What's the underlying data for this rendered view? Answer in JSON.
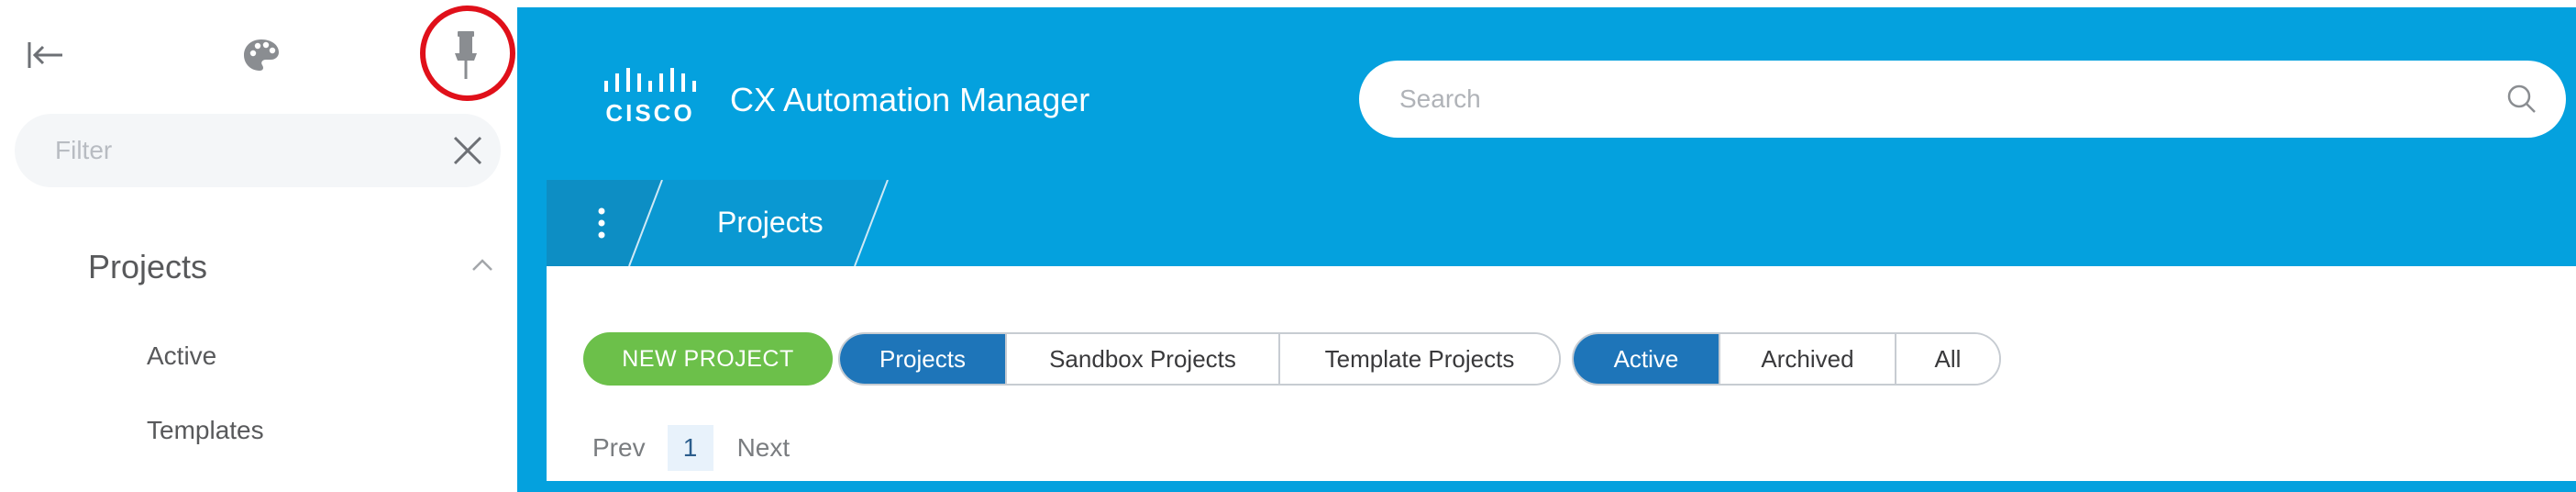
{
  "sidebar": {
    "filter_placeholder": "Filter",
    "section_title": "Projects",
    "items": [
      {
        "label": "Active"
      },
      {
        "label": "Templates"
      }
    ],
    "icons": {
      "collapse": "collapse-sidebar-icon",
      "theme": "palette-icon",
      "pin": "pin-icon",
      "clear": "close-icon",
      "section": "chevron-up-icon"
    },
    "highlight_color": "#e0101a"
  },
  "header": {
    "logo_text": "CISCO",
    "app_title": "CX Automation Manager",
    "search_placeholder": "Search",
    "accent_color": "#04a1de"
  },
  "breadcrumb": {
    "current": "Projects"
  },
  "toolbar": {
    "new_project_label": "NEW PROJECT",
    "new_project_color": "#6cc04a",
    "project_types": [
      "Projects",
      "Sandbox Projects",
      "Template Projects"
    ],
    "selected_type": "Projects",
    "statuses": [
      "Active",
      "Archived",
      "All"
    ],
    "selected_status": "Active",
    "selected_color": "#1e75b9"
  },
  "pagination": {
    "prev_label": "Prev",
    "current_page": "1",
    "next_label": "Next"
  }
}
